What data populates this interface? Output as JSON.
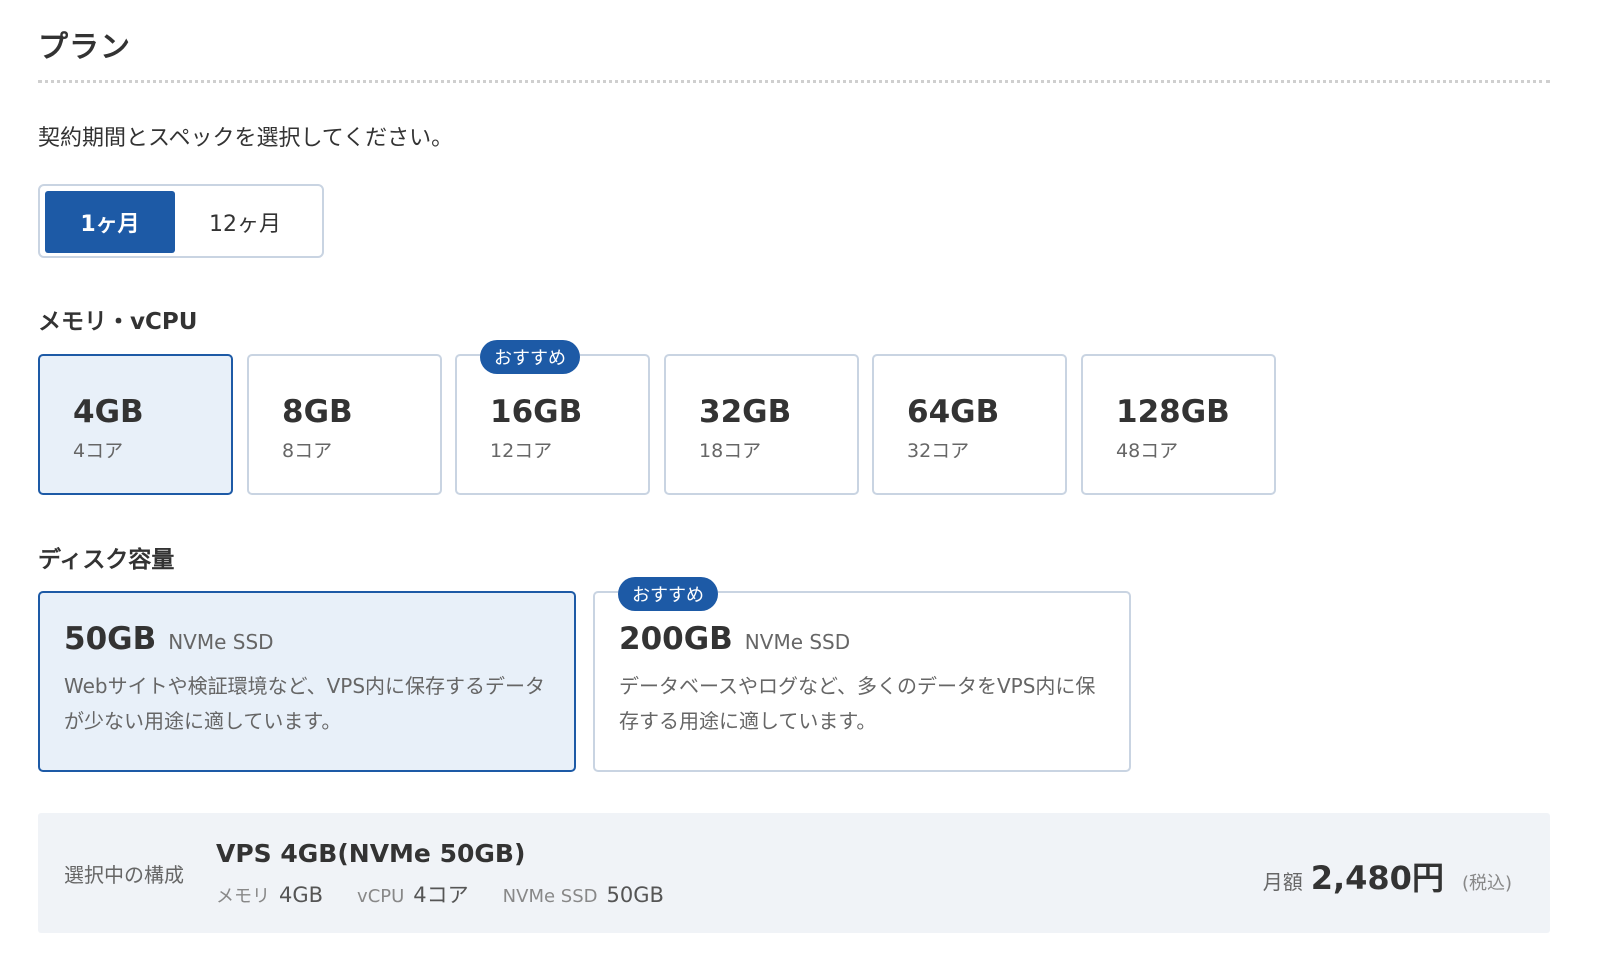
{
  "page": {
    "title": "プラン",
    "description": "契約期間とスペックを選択してください。"
  },
  "period": {
    "options": [
      "1ヶ月",
      "12ヶ月"
    ],
    "selected": "1ヶ月"
  },
  "memory": {
    "label": "メモリ・vCPU",
    "options": [
      {
        "size": "4GB",
        "cores": "4コア",
        "selected": true
      },
      {
        "size": "8GB",
        "cores": "8コア"
      },
      {
        "size": "16GB",
        "cores": "12コア",
        "badge": "おすすめ"
      },
      {
        "size": "32GB",
        "cores": "18コア"
      },
      {
        "size": "64GB",
        "cores": "32コア"
      },
      {
        "size": "128GB",
        "cores": "48コア"
      }
    ]
  },
  "disk": {
    "label": "ディスク容量",
    "options": [
      {
        "size": "50GB",
        "type": "NVMe SSD",
        "description": "Webサイトや検証環境など、VPS内に保存するデータが少ない用途に適しています。",
        "selected": true
      },
      {
        "size": "200GB",
        "type": "NVMe SSD",
        "description": "データベースやログなど、多くのデータをVPS内に保存する用途に適しています。",
        "badge": "おすすめ"
      }
    ]
  },
  "summary": {
    "label": "選択中の構成",
    "title": "VPS 4GB(NVMe 50GB)",
    "specs": [
      {
        "key": "メモリ",
        "value": "4GB"
      },
      {
        "key": "vCPU",
        "value": "4コア"
      },
      {
        "key": "NVMe SSD",
        "value": "50GB"
      }
    ],
    "price_label": "月額",
    "price": "2,480円",
    "tax_note": "(税込)"
  },
  "colors": {
    "accent": "#1d5aa6",
    "selected_bg": "#e8f0f9",
    "border": "#c9d4e2",
    "summary_bg": "#f0f3f7"
  }
}
